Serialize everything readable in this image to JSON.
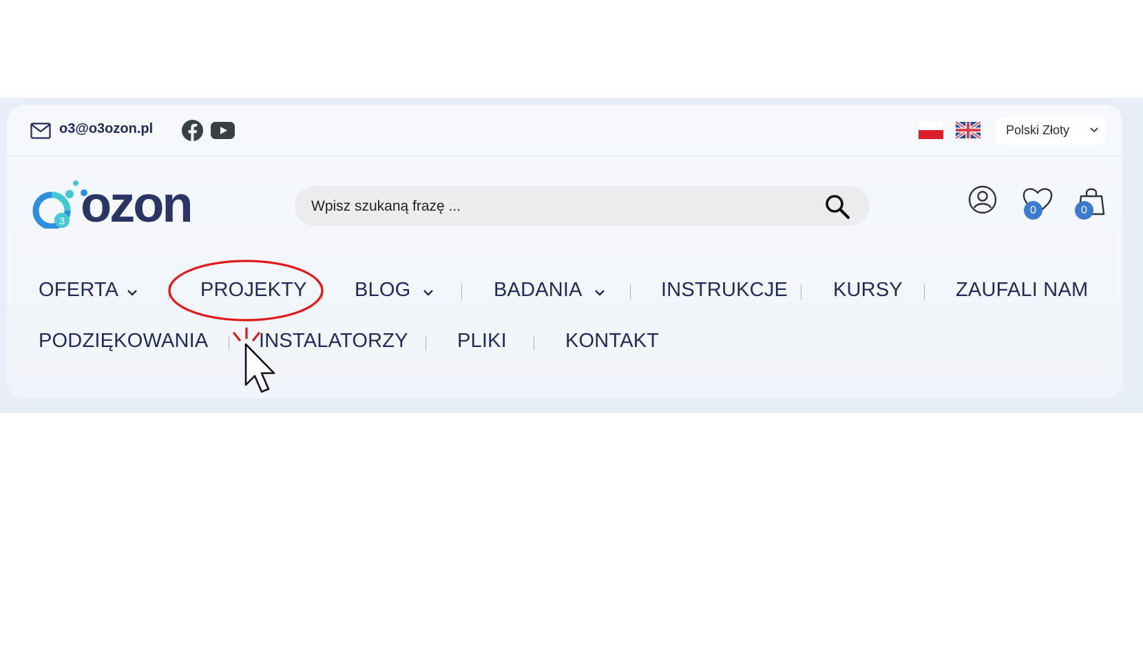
{
  "topbar": {
    "email": "o3@o3ozon.pl",
    "social": [
      "facebook-icon",
      "youtube-icon"
    ],
    "languages": [
      "pl-flag",
      "uk-flag"
    ],
    "currency": "Polski Złoty"
  },
  "logo": {
    "text": "ozon",
    "badge": "3"
  },
  "search": {
    "placeholder": "Wpisz szukaną frazę ..."
  },
  "icons": {
    "wishlist_count": "0",
    "cart_count": "0"
  },
  "nav": {
    "row1": [
      {
        "label": "OFERTA",
        "dropdown": true
      },
      {
        "label": "PROJEKTY",
        "dropdown": false
      },
      {
        "label": "BLOG",
        "dropdown": true
      },
      {
        "label": "BADANIA",
        "dropdown": true
      },
      {
        "label": "INSTRUKCJE",
        "dropdown": false
      },
      {
        "label": "KURSY",
        "dropdown": false
      },
      {
        "label": "ZAUFALI NAM",
        "dropdown": false
      }
    ],
    "row2": [
      {
        "label": "PODZIĘKOWANIA",
        "dropdown": false
      },
      {
        "label": "INSTALATORZY",
        "dropdown": false
      },
      {
        "label": "PLIKI",
        "dropdown": false
      },
      {
        "label": "KONTAKT",
        "dropdown": false
      }
    ]
  },
  "colors": {
    "brand_navy": "#1f2a5a",
    "brand_blue": "#2e8fe0",
    "brand_teal": "#41c9d6",
    "badge_blue": "#3a7bd0",
    "annotation_red": "#e01818"
  }
}
